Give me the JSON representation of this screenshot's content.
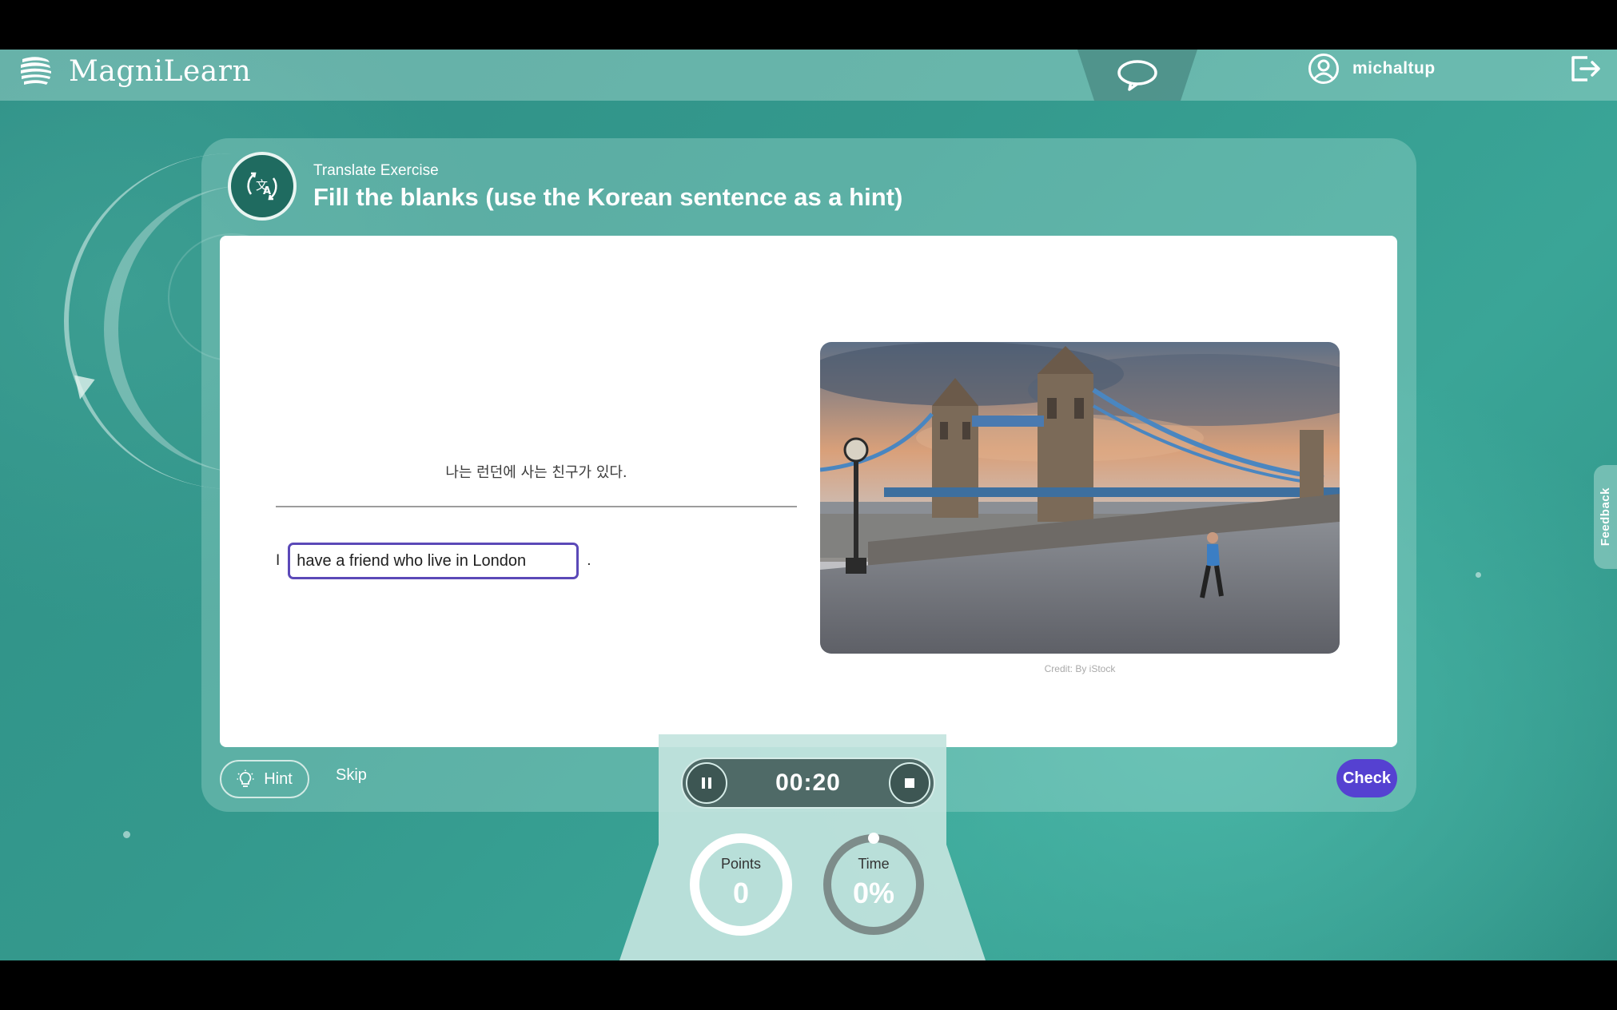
{
  "app": {
    "name": "MagniLearn"
  },
  "user": {
    "name": "michaltup"
  },
  "exercise": {
    "type": "Translate Exercise",
    "title": "Fill the blanks (use the Korean sentence as a hint)",
    "hint_sentence": "나는 런던에 사는 친구가 있다.",
    "prefix": "I",
    "answer_value": "have a friend who live in London",
    "suffix": ".",
    "image_credit": "Credit: By iStock"
  },
  "actions": {
    "hint": "Hint",
    "skip": "Skip",
    "check": "Check"
  },
  "timer": {
    "display": "00:20"
  },
  "stats": {
    "points_label": "Points",
    "points_value": "0",
    "time_label": "Time",
    "time_value": "0%",
    "time_fraction": 0.0
  },
  "feedback_tab": "Feedback",
  "colors": {
    "accent": "#5541d1",
    "teal_dark": "#1f6b60",
    "input_border": "#5b49b8"
  }
}
